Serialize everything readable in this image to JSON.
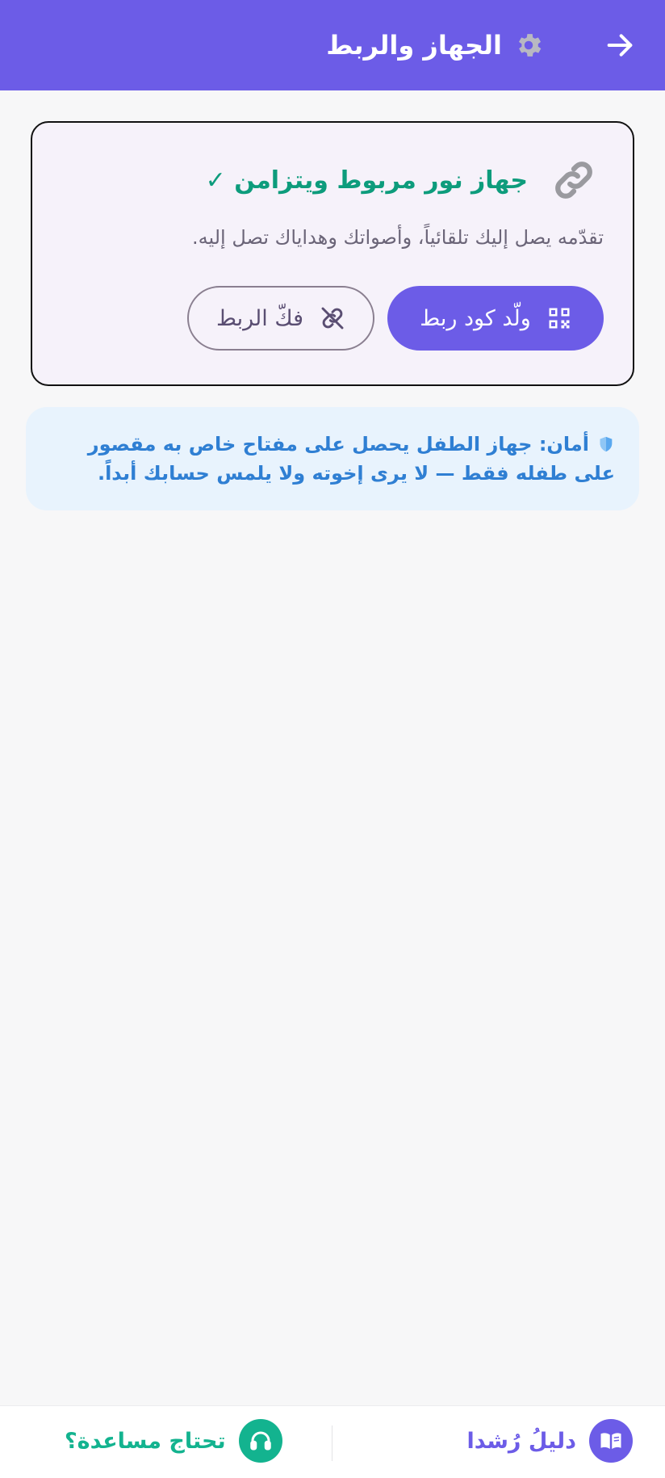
{
  "header": {
    "title": "الجهاز والربط",
    "background": "#6c5ce7"
  },
  "device_card": {
    "title": "جهاز نور مربوط ويتزامن ✓",
    "description": "تقدّمه يصل إليك تلقائياً، وأصواتك وهداياك تصل إليه.",
    "generate_button_label": "ولّد كود ربط",
    "unlink_button_label": "فكّ الربط",
    "title_color": "#0d9c7c"
  },
  "security_notice": {
    "text": "أمان: جهاز الطفل يحصل على مفتاح خاص به مقصور على طفله فقط — لا يرى إخوته ولا يلمس حسابك أبداً."
  },
  "bottom_bar": {
    "guide_label": "دليلُ رُشدا",
    "help_label": "تحتاج مساعدة؟",
    "guide_color": "#6c5ce7",
    "help_color": "#13b38f"
  },
  "icons": {
    "back": "arrow-right-icon",
    "gear": "gear-icon",
    "link": "link-icon",
    "qr": "qr-code-icon",
    "unlink": "unlink-icon",
    "shield": "shield-icon",
    "book": "book-icon",
    "headset": "headset-icon"
  }
}
